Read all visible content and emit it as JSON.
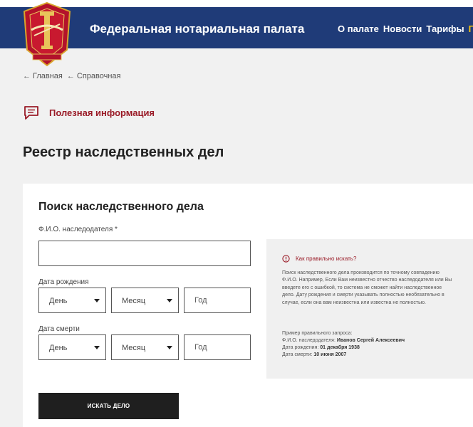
{
  "header": {
    "title": "Федеральная нотариальная палата",
    "nav": [
      "О палате",
      "Новости",
      "Тарифы",
      "П"
    ],
    "emblem_text": "НОТАРИАТ"
  },
  "breadcrumbs": [
    "Главная",
    "Справочная"
  ],
  "useful_info": "Полезная информация",
  "page_title": "Реестр наследственных дел",
  "form": {
    "title": "Поиск наследственного дела",
    "name_label": "Ф.И.О. наследодателя *",
    "name_value": "",
    "birth_label": "Дата рождения",
    "death_label": "Дата смерти",
    "day": "День",
    "month": "Месяц",
    "year_placeholder": "Год",
    "submit": "ИСКАТЬ ДЕЛО"
  },
  "hint": {
    "title": "Как правильно искать?",
    "text": "Поиск наследственного дела производится по точному совпадению Ф.И.О. Например, Если Вам неизвестно отчество наследодателя или Вы введете его с ошибкой, то система не сможет найти наследственное дело. Дату рождения и смерти указывать полностью необязательно в случае, если она вам неизвестна или известна не полностью.",
    "example_heading": "Пример правильного запроса:",
    "example_name_label": "Ф.И.О. наследодателя:",
    "example_name": "Иванов Сергей Алексеевич",
    "example_birth_label": "Дата рождения:",
    "example_birth": "01 декабря 1938",
    "example_death_label": "Дата смерти:",
    "example_death": "10 июня 2007"
  },
  "colors": {
    "header_bg": "#1f3b78",
    "accent_red": "#9a1b27",
    "nav_accent": "#f4c20d",
    "button_bg": "#1f1f1f"
  }
}
